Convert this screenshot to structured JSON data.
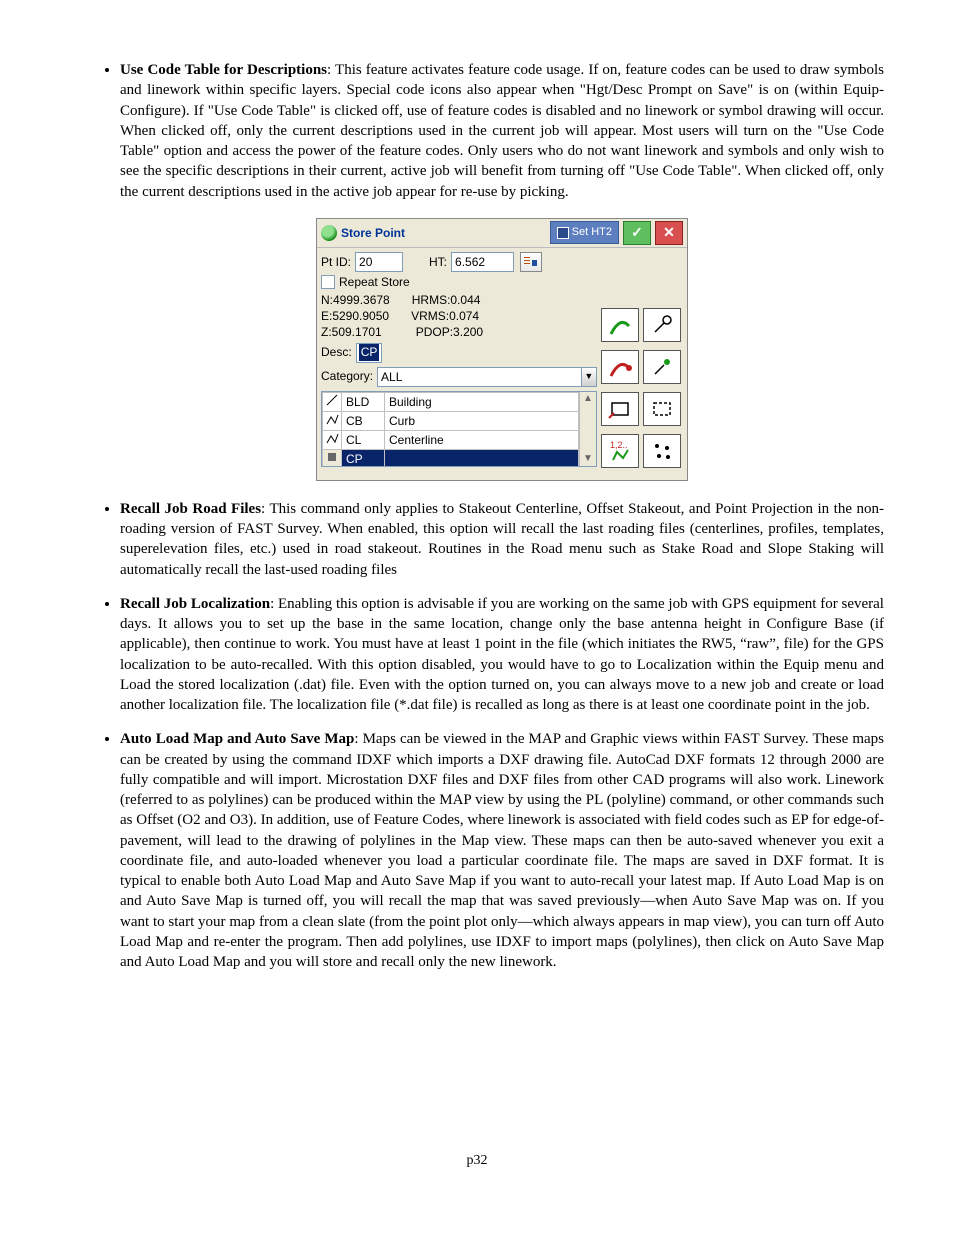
{
  "bullets": {
    "codeTable": {
      "title": "Use Code Table for Descriptions",
      "text": ": This feature activates feature code usage.  If on, feature codes can be used to draw symbols and linework within specific layers.  Special code icons also appear when \"Hgt/Desc Prompt on Save\" is on (within Equip-Configure).  If \"Use Code Table\" is clicked off, use of feature codes is disabled and no linework or symbol drawing will occur.  When clicked off, only the current descriptions used in the current job will appear.  Most users will turn on the \"Use Code Table\" option and access the power of the feature codes.  Only users who do not want linework and symbols and only wish to see the specific descriptions in their current, active job will benefit from turning off \"Use Code Table\".   When clicked off, only the current descriptions used in the active job appear for re-use by picking."
    },
    "recallRoad": {
      "title": "Recall Job Road Files",
      "text": ": This command only applies to Stakeout Centerline, Offset Stakeout, and Point Projection in the non-roading version of FAST Survey.  When enabled, this option will recall the last roading files (centerlines, profiles, templates, superelevation files, etc.) used in road stakeout.  Routines in the Road menu such as Stake Road and Slope Staking will automatically recall the last-used roading files"
    },
    "recallLoc": {
      "title": "Recall Job Localization",
      "text": ": Enabling this option is advisable if you are working on the same job with GPS equipment for several days.  It allows you to set up the base in the same location, change only the base antenna height in Configure Base (if applicable), then continue to work. You must have at least 1 point in the file (which initiates the RW5, “raw”, file) for the GPS localization to be auto-recalled. With this option disabled, you would have to go to Localization within the Equip menu and Load the stored localization (.dat) file.  Even with the option turned on, you can always move to a new job and create or load another localization file.  The localization file (*.dat file) is recalled as long as there is at least one coordinate point in the job."
    },
    "autoLoad": {
      "title": "Auto Load Map and Auto Save Map",
      "text": ": Maps can be viewed in the MAP and Graphic views within FAST Survey. These maps can be created by using the command IDXF which imports a DXF drawing file. AutoCad DXF formats 12 through 2000 are fully compatible and will import. Microstation DXF files and DXF files from other CAD programs will also work.  Linework (referred to as polylines) can be produced within the MAP view by using the PL (polyline) command, or other commands such as Offset (O2 and O3).  In addition, use of Feature Codes, where linework is associated with field codes such as EP for edge-of-pavement, will lead to the drawing of polylines in the Map view.  These maps can then be auto-saved whenever you exit a coordinate file, and auto-loaded whenever you load a particular coordinate file.  The maps are saved in DXF format.  It is typical to enable both Auto Load Map and Auto Save Map if you want to auto-recall your latest map.  If Auto Load Map is on and Auto Save Map is turned off, you will recall the map that was saved previously—when Auto Save Map was on.  If you want to start your map from a clean slate (from the point plot only—which always appears in map view), you can turn off Auto Load Map and re-enter the program.  Then add polylines, use IDXF to import maps (polylines), then click on Auto Save Map and Auto Load Map and you will store and recall only the new linework."
    }
  },
  "screenshot": {
    "title": "Store Point",
    "setHt2": "Set HT2",
    "labels": {
      "ptId": "Pt ID:",
      "ht": "HT:",
      "repeatStore": "Repeat Store",
      "desc": "Desc:",
      "category": "Category:"
    },
    "values": {
      "ptId": "20",
      "ht": "6.562",
      "N": "N:4999.3678",
      "E": "E:5290.9050",
      "Z": "Z:509.1701",
      "HRMS": "HRMS:0.044",
      "VRMS": "VRMS:0.074",
      "PDOP": "PDOP:3.200",
      "desc": "CP",
      "category": "ALL"
    },
    "codeList": [
      {
        "code": "BLD",
        "desc": "Building"
      },
      {
        "code": "CB",
        "desc": "Curb"
      },
      {
        "code": "CL",
        "desc": "Centerline"
      },
      {
        "code": "CP",
        "desc": ""
      }
    ]
  },
  "pageNumber": "p32"
}
